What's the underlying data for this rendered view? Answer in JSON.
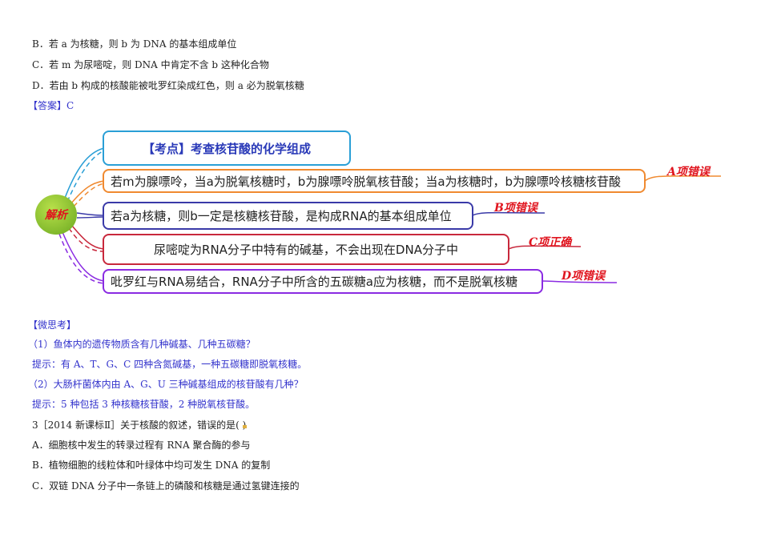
{
  "question_top": {
    "option_b": "B．若 a 为核糖，则 b 为 DNA 的基本组成单位",
    "option_c": "C．若 m 为尿嘧啶，则 DNA 中肯定不含 b 这种化合物",
    "option_d": "D．若由 b 构成的核酸能被吡罗红染成红色，则 a 必为脱氧核糖",
    "answer": "【答案】C"
  },
  "mindmap": {
    "hub": "解析",
    "topic": "【考点】考查核苷酸的化学组成",
    "branches": [
      {
        "text": "若m为腺嘌呤，当a为脱氧核糖时，b为腺嘌呤脱氧核苷酸；当a为核糖时，b为腺嘌呤核糖核苷酸",
        "verdict": "A项错误",
        "color": "#f08a30"
      },
      {
        "text": "若a为核糖，则b一定是核糖核苷酸，是构成RNA的基本组成单位",
        "verdict": "B项错误",
        "color": "#3a3aa8"
      },
      {
        "text": "尿嘧啶为RNA分子中特有的碱基，不会出现在DNA分子中",
        "verdict": "C项正确",
        "color": "#c8283c"
      },
      {
        "text": "吡罗红与RNA易结合，RNA分子中所含的五碳糖a应为核糖，而不是脱氧核糖",
        "verdict": "D项错误",
        "color": "#8a2be2"
      }
    ],
    "topic_color": "#2a9fd6"
  },
  "micro": {
    "heading": "【微思考】",
    "q1": "（1）鱼体内的遗传物质含有几种碱基、几种五碳糖？",
    "a1": "提示：有 A、T、G、C 四种含氮碱基，一种五碳糖即脱氧核糖。",
    "q2": "（2）大肠杆菌体内由 A、G、U 三种碱基组成的核苷酸有几种？",
    "a2": "提示：5 种包括 3 种核糖核苷酸，2 种脱氧核苷酸。"
  },
  "question3": {
    "stem": "3［2014 新课标Ⅱ］关于核酸的叙述，错误的是(    )",
    "option_a": "A．细胞核中发生的转录过程有 RNA 聚合酶的参与",
    "option_b": "B．植物细胞的线粒体和叶绿体中均可发生 DNA 的复制",
    "option_c": "C．双链 DNA 分子中一条链上的磷酸和核糖是通过氢键连接的"
  }
}
